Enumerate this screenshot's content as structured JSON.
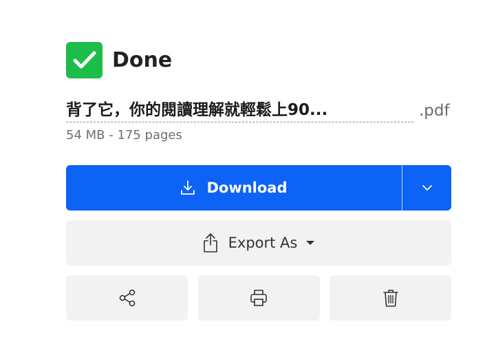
{
  "status": {
    "text": "Done",
    "icon": "checkmark-icon",
    "color": "#1dbd4a"
  },
  "file": {
    "name": "背了它，你的閱讀理解就輕鬆上90...",
    "extension": ".pdf",
    "meta": "54 MB - 175 pages"
  },
  "download": {
    "label": "Download",
    "icon": "download-icon",
    "dropdown_icon": "chevron-down-icon",
    "color": "#0d63f5"
  },
  "export": {
    "label": "Export As",
    "icon": "share-upload-icon",
    "caret_icon": "caret-down-icon"
  },
  "actions": [
    {
      "icon": "share-icon"
    },
    {
      "icon": "print-icon"
    },
    {
      "icon": "trash-icon"
    }
  ]
}
